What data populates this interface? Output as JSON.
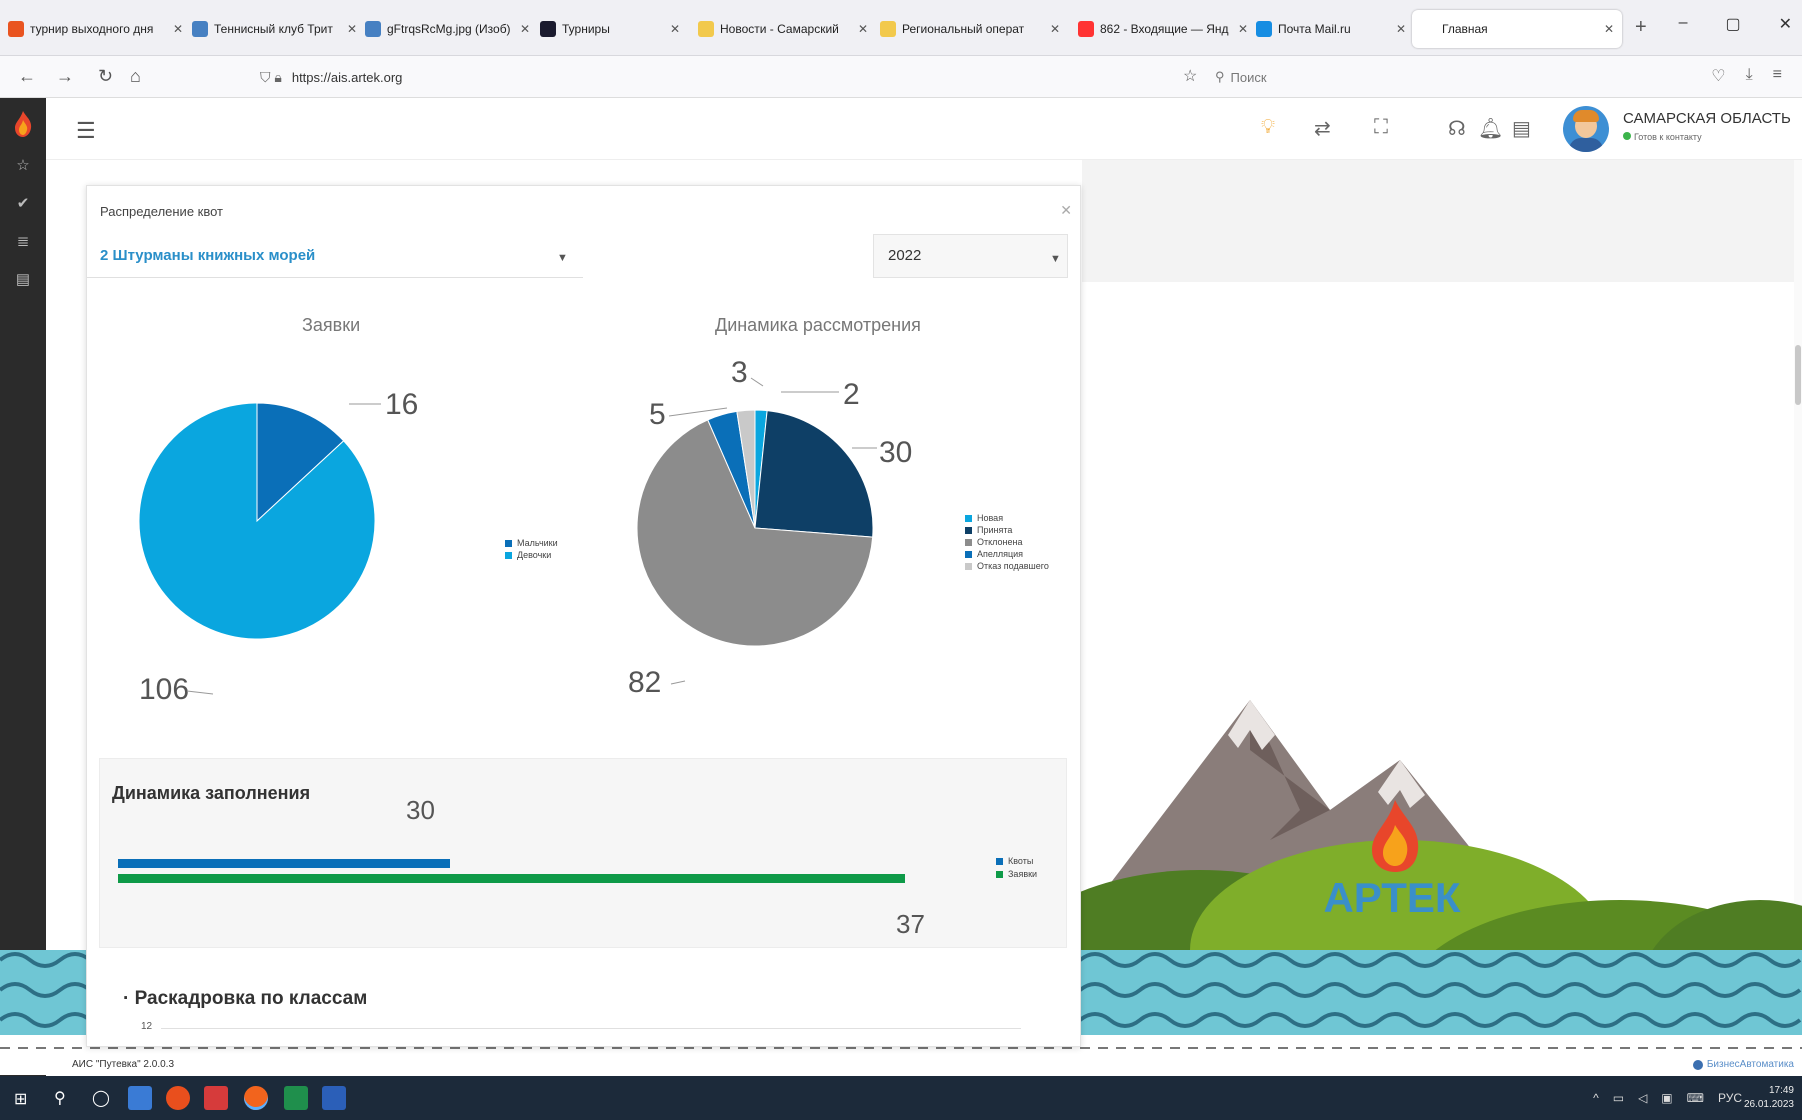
{
  "browser": {
    "tabs": [
      {
        "label": "турнир выходного дня",
        "color": "#e95420"
      },
      {
        "label": "Теннисный клуб Трит",
        "color": "#4680c2"
      },
      {
        "label": "gFtrqsRcMg.jpg (Изоб)",
        "color": "#4680c2"
      },
      {
        "label": "Турниры",
        "color": "#1a1a2e"
      },
      {
        "label": "Новости - Самарский",
        "color": "#f2c94c"
      },
      {
        "label": "Региональный операт",
        "color": "#f2c94c"
      },
      {
        "label": "862 - Входящие — Янд",
        "color": "#ff3333"
      },
      {
        "label": "Почта Mail.ru",
        "color": "#168de2"
      },
      {
        "label": "Главная",
        "color": "#ffffff"
      }
    ],
    "url": "https://ais.artek.org",
    "search_placeholder": "Поиск"
  },
  "header": {
    "user_name": "САМАРСКАЯ ОБЛАСТЬ",
    "user_status": "Готов к контакту"
  },
  "panel": {
    "title": "Распределение квот",
    "program_select": "2 Штурманы книжных морей",
    "year_select": "2022"
  },
  "charts": {
    "applications": {
      "title": "Заявки",
      "label_a": "16",
      "label_b": "106"
    },
    "review": {
      "title": "Динамика рассмотрения",
      "label_new": "2",
      "label_accepted": "30",
      "label_rejected": "82",
      "label_appeal": "5",
      "label_refusal": "3"
    },
    "filling": {
      "title": "Динамика заполнения",
      "top_value": "30",
      "bottom_value": "37"
    }
  },
  "chart_data": [
    {
      "type": "pie",
      "title": "Заявки",
      "labels": [
        "Мальчики",
        "Девочки"
      ],
      "values": [
        16,
        106
      ],
      "colors": [
        "#0a6fb8",
        "#0aa6df"
      ]
    },
    {
      "type": "pie",
      "title": "Динамика рассмотрения",
      "labels": [
        "Новая",
        "Принята",
        "Отклонена",
        "Апелляция",
        "Отказ подавшего"
      ],
      "values": [
        2,
        30,
        82,
        5,
        3
      ],
      "colors": [
        "#0aa6df",
        "#0e3f66",
        "#8c8c8c",
        "#0a6fb8",
        "#c9c9c9"
      ]
    },
    {
      "type": "bar",
      "title": "Динамика заполнения",
      "orientation": "horizontal",
      "series": [
        {
          "name": "Квоты",
          "values": [
            30
          ],
          "color": "#0a6fb8"
        },
        {
          "name": "Заявки",
          "values": [
            37
          ],
          "color": "#0e9a48"
        }
      ]
    }
  ],
  "classes": {
    "title": "Раскадровка по классам",
    "tick": "12"
  },
  "footer": {
    "version": "АИС \"Путевка\" 2.0.0.3",
    "vendor": "БизнесАвтоматика"
  },
  "taskbar": {
    "lang": "РУС",
    "time": "17:49",
    "date": "26.01.2023"
  },
  "landscape": {
    "logo_text": "АРТЕК"
  }
}
